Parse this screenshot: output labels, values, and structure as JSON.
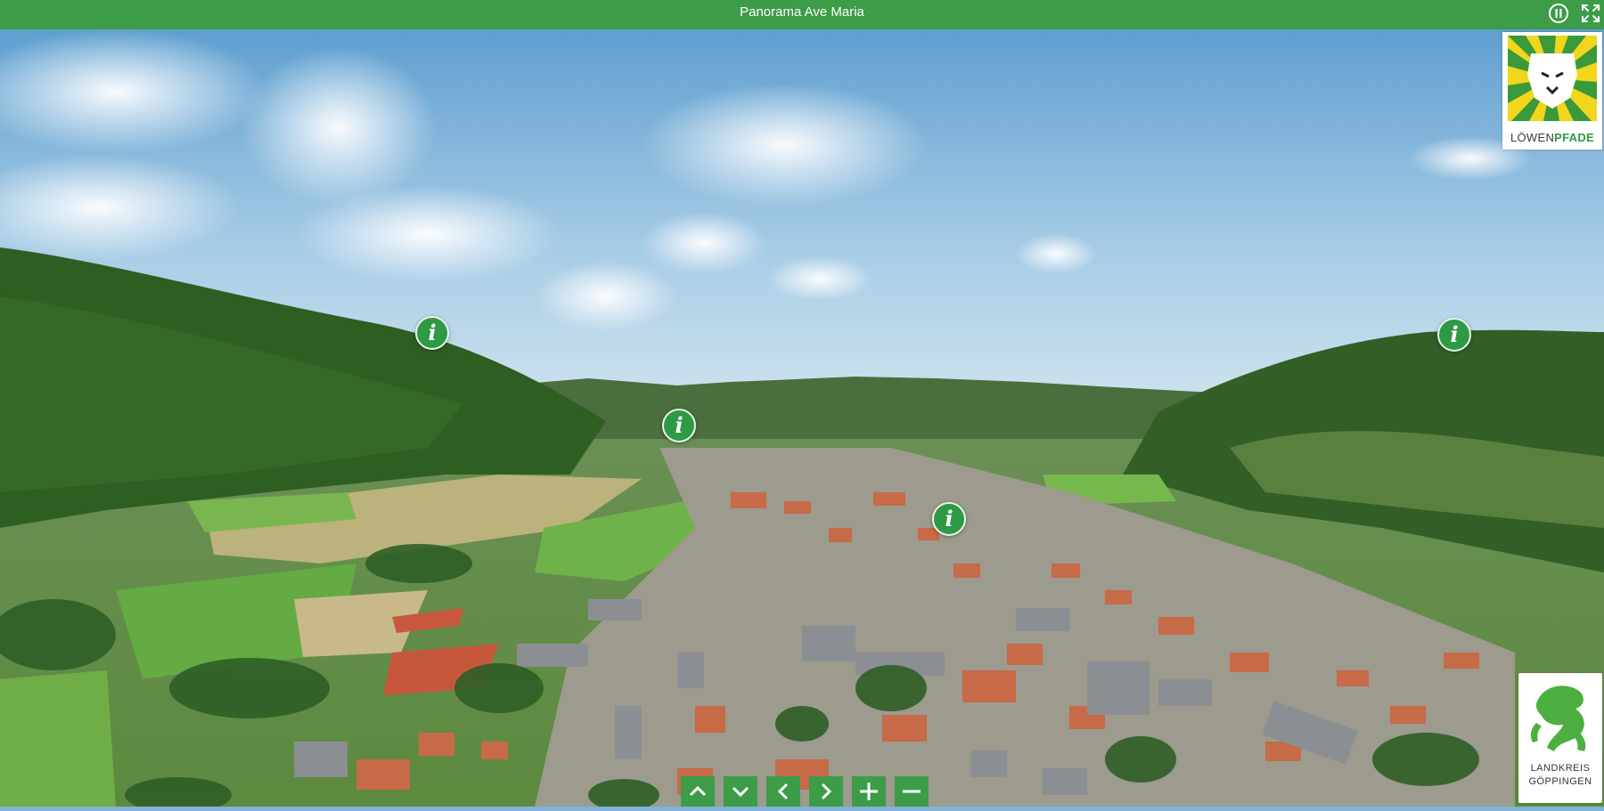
{
  "app": {
    "title": "Panorama Ave Maria"
  },
  "toolbar": {
    "autorotate_icon": "pause-circle-icon",
    "fullscreen_icon": "fullscreen-icon"
  },
  "hotspots": [
    {
      "icon": "info-icon",
      "glyph": "i"
    },
    {
      "icon": "info-icon",
      "glyph": "i"
    },
    {
      "icon": "info-icon",
      "glyph": "i"
    },
    {
      "icon": "info-icon",
      "glyph": "i"
    }
  ],
  "logos": {
    "top": {
      "text_a": "LÖWEN",
      "text_b": "PFADE"
    },
    "bottom": {
      "line1": "LANDKREIS",
      "line2": "GÖPPINGEN"
    }
  },
  "controls": [
    {
      "name": "up",
      "icon": "chevron-up-icon"
    },
    {
      "name": "down",
      "icon": "chevron-down-icon"
    },
    {
      "name": "left",
      "icon": "chevron-left-icon"
    },
    {
      "name": "right",
      "icon": "chevron-right-icon"
    },
    {
      "name": "zoom-in",
      "icon": "plus-icon"
    },
    {
      "name": "zoom-out",
      "icon": "minus-icon"
    }
  ],
  "colors": {
    "brand_green": "#3c9c48",
    "sky": "#7fb3d8",
    "forest": "#2e5e22"
  }
}
